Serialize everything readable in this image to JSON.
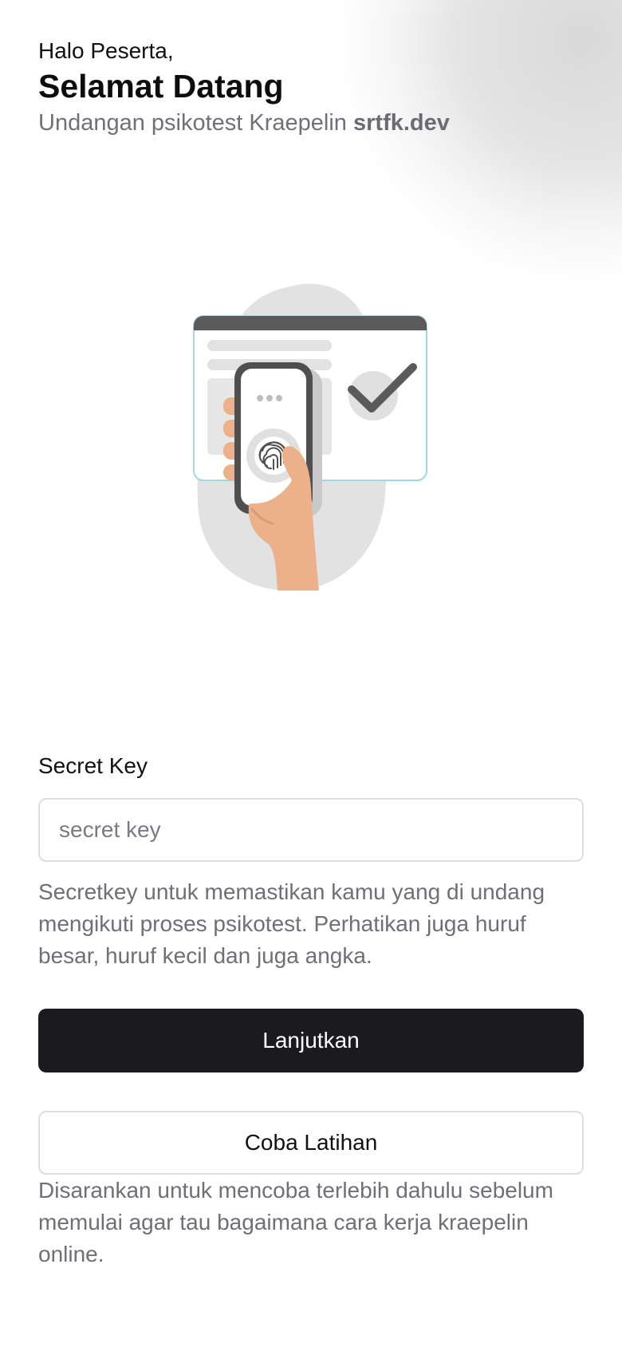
{
  "header": {
    "greeting": "Halo Peserta,",
    "welcome": "Selamat Datang",
    "subtitle_prefix": "Undangan psikotest Kraepelin",
    "subtitle_domain": "srtfk.dev"
  },
  "illustration": {
    "icon": "fingerprint-verification-illustration"
  },
  "form": {
    "secret_key_label": "Secret Key",
    "secret_key_placeholder": "secret key",
    "secret_key_value": "",
    "secret_key_help": "Secretkey untuk memastikan kamu yang di undang mengikuti proses psikotest. Perhatikan juga huruf besar, huruf kecil dan juga angka."
  },
  "actions": {
    "continue_label": "Lanjutkan",
    "practice_label": "Coba Latihan",
    "practice_note": "Disarankan untuk mencoba terlebih dahulu sebelum memulai agar tau bagaimana cara kerja kraepelin online."
  },
  "colors": {
    "primary_button": "#1b1b1f",
    "muted_text": "#6f6f77",
    "skin": "#ecb08a",
    "accent_border": "#8fd3df"
  }
}
